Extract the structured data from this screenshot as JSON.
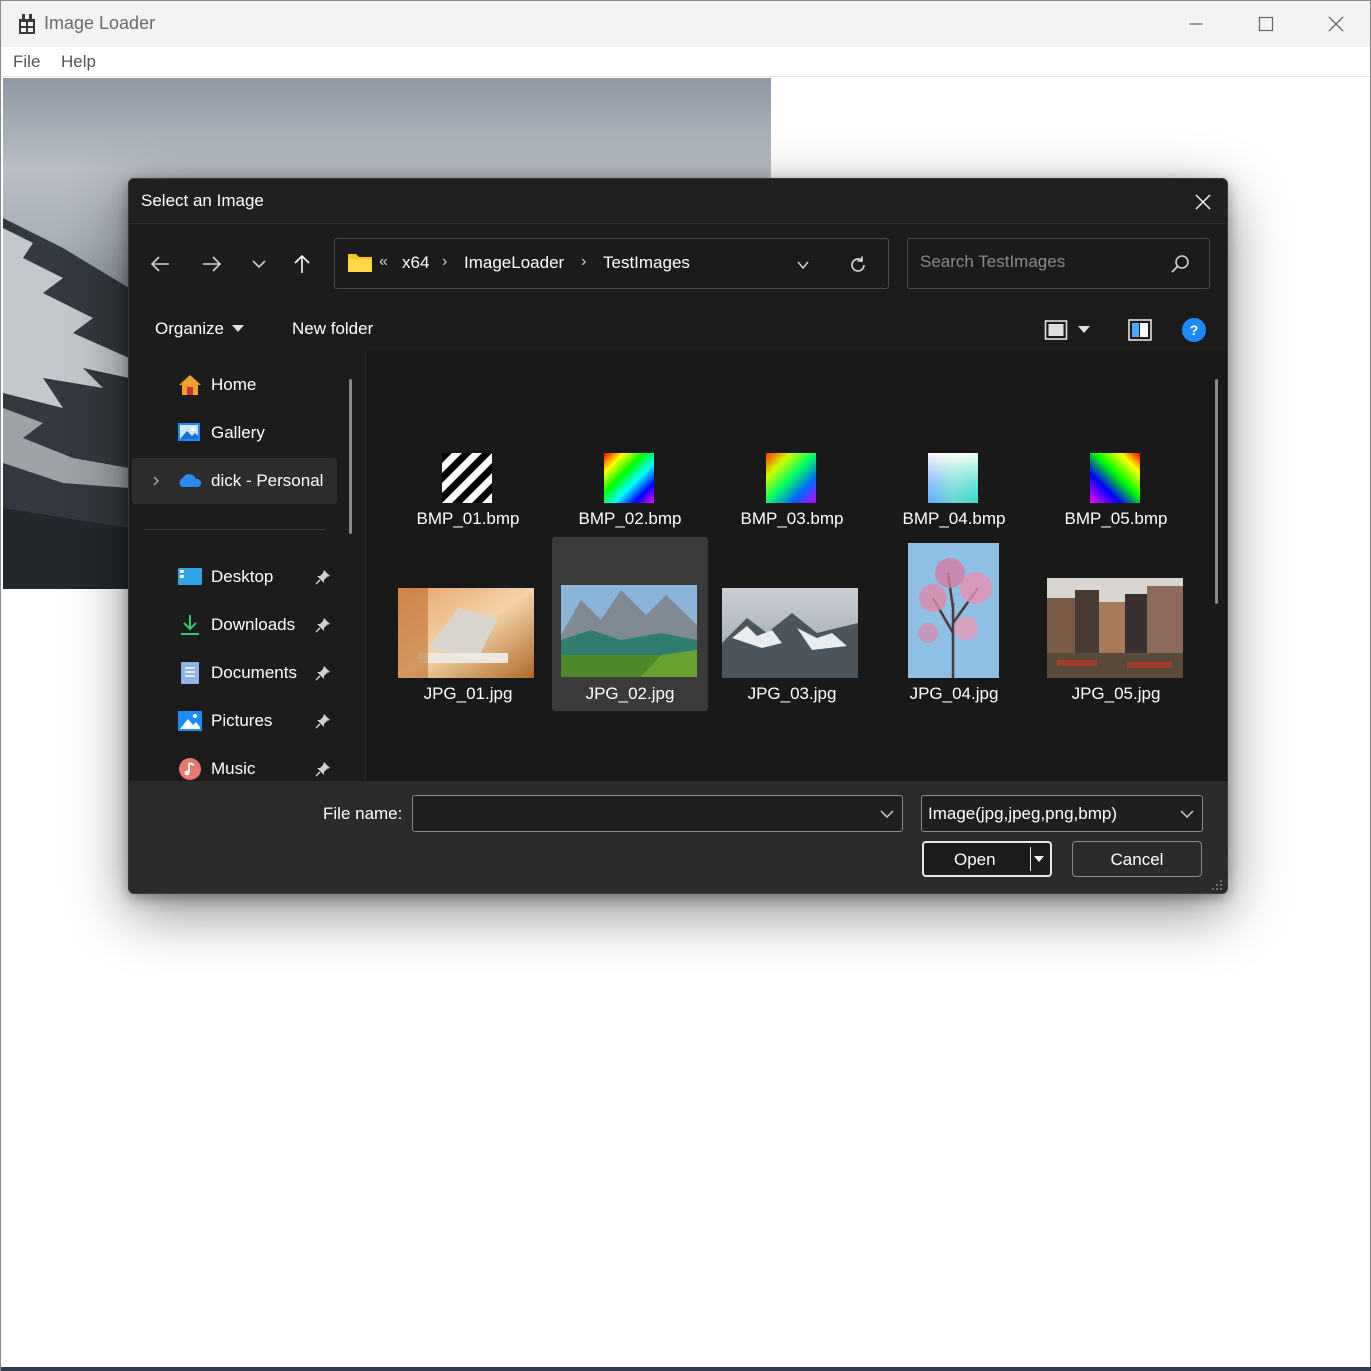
{
  "app": {
    "title": "Image Loader",
    "menu": [
      "File",
      "Help"
    ]
  },
  "dialog": {
    "title": "Select an Image",
    "breadcrumb": {
      "overflow": "«",
      "items": [
        "x64",
        "ImageLoader",
        "TestImages"
      ]
    },
    "search_placeholder": "Search TestImages",
    "toolbar": {
      "organize_label": "Organize",
      "new_folder_label": "New folder"
    },
    "nav_pane": [
      {
        "label": "Home",
        "icon": "home-icon"
      },
      {
        "label": "Gallery",
        "icon": "gallery-icon"
      },
      {
        "label": "dick - Personal",
        "icon": "onedrive-cloud-icon",
        "selected": true
      },
      {
        "label": "Desktop",
        "icon": "desktop-icon",
        "pinned": true
      },
      {
        "label": "Downloads",
        "icon": "downloads-icon",
        "pinned": true
      },
      {
        "label": "Documents",
        "icon": "documents-icon",
        "pinned": true
      },
      {
        "label": "Pictures",
        "icon": "pictures-icon",
        "pinned": true
      },
      {
        "label": "Music",
        "icon": "music-icon",
        "pinned": true
      }
    ],
    "files": [
      {
        "name": "BMP_01.bmp"
      },
      {
        "name": "BMP_02.bmp"
      },
      {
        "name": "BMP_03.bmp"
      },
      {
        "name": "BMP_04.bmp"
      },
      {
        "name": "BMP_05.bmp"
      },
      {
        "name": "JPG_01.jpg"
      },
      {
        "name": "JPG_02.jpg",
        "selected": true
      },
      {
        "name": "JPG_03.jpg"
      },
      {
        "name": "JPG_04.jpg"
      },
      {
        "name": "JPG_05.jpg"
      }
    ],
    "bottom": {
      "file_name_label": "File name:",
      "file_name_value": "",
      "file_type": "Image(jpg,jpeg,png,bmp)",
      "open_label": "Open",
      "cancel_label": "Cancel"
    }
  },
  "colors": {
    "dialog_bg": "#191919",
    "accent": "#1a8cff",
    "folder_yellow": "#f5c518"
  }
}
